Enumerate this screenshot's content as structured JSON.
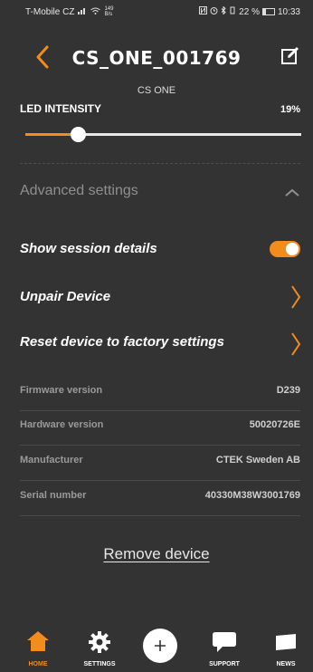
{
  "status_bar": {
    "carrier": "T-Mobile CZ",
    "net_speed": "149",
    "net_speed_unit": "B/s",
    "battery_percent": "22 %",
    "time": "10:33"
  },
  "header": {
    "title": "CS_ONE_001769",
    "subtitle": "CS ONE"
  },
  "led": {
    "label": "LED INTENSITY",
    "value_text": "19%",
    "level_fraction": 0.19
  },
  "advanced": {
    "title": "Advanced settings"
  },
  "options": {
    "show_session": "Show session details",
    "show_session_enabled": true,
    "unpair": "Unpair Device",
    "reset": "Reset device to factory settings"
  },
  "info": [
    {
      "label": "Firmware version",
      "value": "D239"
    },
    {
      "label": "Hardware version",
      "value": "50020726E"
    },
    {
      "label": "Manufacturer",
      "value": "CTEK Sweden AB"
    },
    {
      "label": "Serial number",
      "value": "40330M38W3001769"
    }
  ],
  "remove_label": "Remove device",
  "tabs": {
    "home": "HOME",
    "settings": "SETTINGS",
    "support": "SUPPORT",
    "news": "NEWS"
  },
  "colors": {
    "accent": "#f28c1c",
    "background": "#333333"
  }
}
